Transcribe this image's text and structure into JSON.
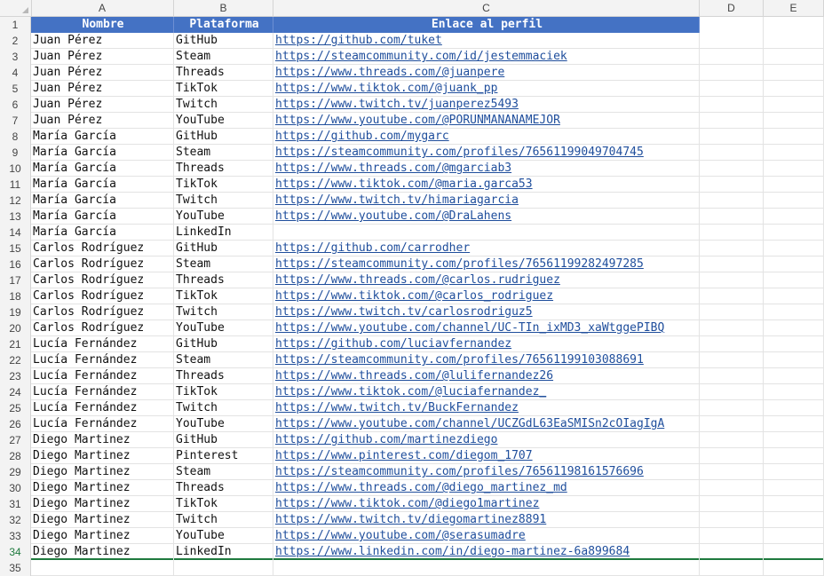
{
  "columns": [
    "A",
    "B",
    "C",
    "D",
    "E"
  ],
  "headers": {
    "nombre": "Nombre",
    "plataforma": "Plataforma",
    "enlace": "Enlace al perfil"
  },
  "rows": [
    {
      "num": "2",
      "name": "Juan Pérez",
      "platform": "GitHub",
      "link": "https://github.com/tuket"
    },
    {
      "num": "3",
      "name": "Juan Pérez",
      "platform": "Steam",
      "link": "https://steamcommunity.com/id/jestemmaciek"
    },
    {
      "num": "4",
      "name": "Juan Pérez",
      "platform": "Threads",
      "link": "https://www.threads.com/@juanpere"
    },
    {
      "num": "5",
      "name": "Juan Pérez",
      "platform": "TikTok",
      "link": "https://www.tiktok.com/@juank_pp"
    },
    {
      "num": "6",
      "name": "Juan Pérez",
      "platform": "Twitch",
      "link": "https://www.twitch.tv/juanperez5493"
    },
    {
      "num": "7",
      "name": "Juan Pérez",
      "platform": "YouTube",
      "link": "https://www.youtube.com/@PORUNMANANAMEJOR"
    },
    {
      "num": "8",
      "name": "María García",
      "platform": "GitHub",
      "link": "https://github.com/mygarc"
    },
    {
      "num": "9",
      "name": "María García",
      "platform": "Steam",
      "link": "https://steamcommunity.com/profiles/76561199049704745"
    },
    {
      "num": "10",
      "name": "María García",
      "platform": "Threads",
      "link": "https://www.threads.com/@mgarciab3"
    },
    {
      "num": "11",
      "name": "María García",
      "platform": "TikTok",
      "link": "https://www.tiktok.com/@maria.garca53"
    },
    {
      "num": "12",
      "name": "María García",
      "platform": "Twitch",
      "link": "https://www.twitch.tv/himariagarcia"
    },
    {
      "num": "13",
      "name": "María García",
      "platform": "YouTube",
      "link": "https://www.youtube.com/@DraLahens"
    },
    {
      "num": "14",
      "name": "María García",
      "platform": "LinkedIn",
      "link": ""
    },
    {
      "num": "15",
      "name": "Carlos Rodríguez",
      "platform": "GitHub",
      "link": "https://github.com/carrodher"
    },
    {
      "num": "16",
      "name": "Carlos Rodríguez",
      "platform": "Steam",
      "link": "https://steamcommunity.com/profiles/76561199282497285"
    },
    {
      "num": "17",
      "name": "Carlos Rodríguez",
      "platform": "Threads",
      "link": "https://www.threads.com/@carlos.rudriguez"
    },
    {
      "num": "18",
      "name": "Carlos Rodríguez",
      "platform": "TikTok",
      "link": "https://www.tiktok.com/@carlos_rodriguez"
    },
    {
      "num": "19",
      "name": "Carlos Rodríguez",
      "platform": "Twitch",
      "link": "https://www.twitch.tv/carlosrodriguz5"
    },
    {
      "num": "20",
      "name": "Carlos Rodríguez",
      "platform": "YouTube",
      "link": "https://www.youtube.com/channel/UC-TIn_ixMD3_xaWtggePIBQ"
    },
    {
      "num": "21",
      "name": "Lucía Fernández",
      "platform": "GitHub",
      "link": "https://github.com/luciavfernandez"
    },
    {
      "num": "22",
      "name": "Lucía Fernández",
      "platform": "Steam",
      "link": "https://steamcommunity.com/profiles/76561199103088691"
    },
    {
      "num": "23",
      "name": "Lucía Fernández",
      "platform": "Threads",
      "link": "https://www.threads.com/@lulifernandez26"
    },
    {
      "num": "24",
      "name": "Lucía Fernández",
      "platform": "TikTok",
      "link": "https://www.tiktok.com/@luciafernandez_"
    },
    {
      "num": "25",
      "name": "Lucía Fernández",
      "platform": "Twitch",
      "link": "https://www.twitch.tv/BuckFernandez"
    },
    {
      "num": "26",
      "name": "Lucía Fernández",
      "platform": "YouTube",
      "link": "https://www.youtube.com/channel/UCZGdL63EaSMISn2cOIagIgA"
    },
    {
      "num": "27",
      "name": "Diego Martinez",
      "platform": "GitHub",
      "link": "https://github.com/martinezdiego"
    },
    {
      "num": "28",
      "name": "Diego Martinez",
      "platform": "Pinterest",
      "link": "https://www.pinterest.com/diegom_1707"
    },
    {
      "num": "29",
      "name": "Diego Martinez",
      "platform": "Steam",
      "link": "https://steamcommunity.com/profiles/76561198161576696"
    },
    {
      "num": "30",
      "name": "Diego Martinez",
      "platform": "Threads",
      "link": "https://www.threads.com/@diego_martinez_md"
    },
    {
      "num": "31",
      "name": "Diego Martinez",
      "platform": "TikTok",
      "link": "https://www.tiktok.com/@diego1martinez"
    },
    {
      "num": "32",
      "name": "Diego Martinez",
      "platform": "Twitch",
      "link": "https://www.twitch.tv/diegomartinez8891"
    },
    {
      "num": "33",
      "name": "Diego Martinez",
      "platform": "YouTube",
      "link": "https://www.youtube.com/@serasumadre"
    },
    {
      "num": "34",
      "name": "Diego Martinez",
      "platform": "LinkedIn",
      "link": "https://www.linkedin.com/in/diego-martinez-6a899684"
    },
    {
      "num": "35",
      "name": "",
      "platform": "",
      "link": ""
    }
  ],
  "header_row_num": "1",
  "active_row": "34",
  "colors": {
    "header_fill": "#4472c4",
    "link": "#1f4e9c",
    "selection": "#1f7a3e"
  }
}
